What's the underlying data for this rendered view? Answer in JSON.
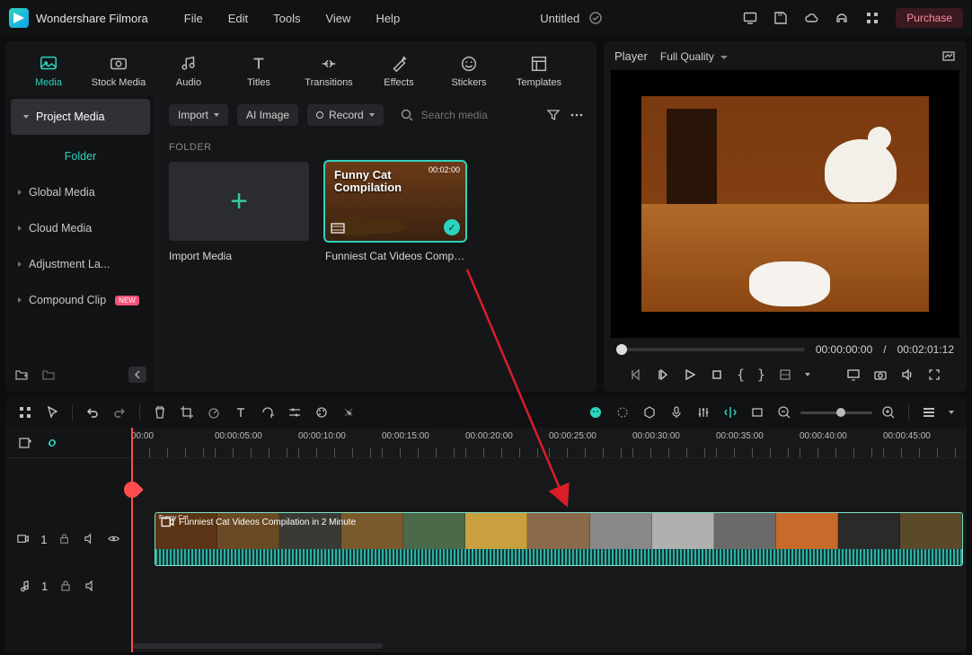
{
  "app_name": "Wondershare Filmora",
  "project_title": "Untitled",
  "purchase_label": "Purchase",
  "menus": [
    "File",
    "Edit",
    "Tools",
    "View",
    "Help"
  ],
  "tabs": [
    {
      "key": "media",
      "label": "Media",
      "active": true
    },
    {
      "key": "stockmedia",
      "label": "Stock Media",
      "active": false
    },
    {
      "key": "audio",
      "label": "Audio",
      "active": false
    },
    {
      "key": "titles",
      "label": "Titles",
      "active": false
    },
    {
      "key": "transitions",
      "label": "Transitions",
      "active": false
    },
    {
      "key": "effects",
      "label": "Effects",
      "active": false
    },
    {
      "key": "stickers",
      "label": "Stickers",
      "active": false
    },
    {
      "key": "templates",
      "label": "Templates",
      "active": false
    }
  ],
  "sidebar": {
    "project_media": "Project Media",
    "folder": "Folder",
    "items": [
      {
        "label": "Global Media"
      },
      {
        "label": "Cloud Media"
      },
      {
        "label": "Adjustment La..."
      },
      {
        "label": "Compound Clip",
        "new": true
      }
    ],
    "new_badge": "NEW"
  },
  "content": {
    "import_btn": "Import",
    "ai_image_btn": "AI Image",
    "record_btn": "Record",
    "search_placeholder": "Search media",
    "folder_heading": "FOLDER",
    "import_card": "Import Media",
    "clip_card": "Funniest Cat Videos Compil...",
    "clip_overlay": "Funny Cat Compilation",
    "clip_duration": "00:02:00"
  },
  "player": {
    "label": "Player",
    "quality": "Full Quality",
    "current": "00:00:00:00",
    "total": "00:02:01:12",
    "slash": "/"
  },
  "timeline": {
    "ticks": [
      "00:00",
      "00:00:05:00",
      "00:00:10:00",
      "00:00:15:00",
      "00:00:20:00",
      "00:00:25:00",
      "00:00:30:00",
      "00:00:35:00",
      "00:00:40:00",
      "00:00:45:00"
    ],
    "clip_label": "Funniest Cat Videos Compilation in 2 Minute",
    "video_track": "1",
    "audio_track": "1",
    "clip_overlay_small": "Funny Cat"
  }
}
